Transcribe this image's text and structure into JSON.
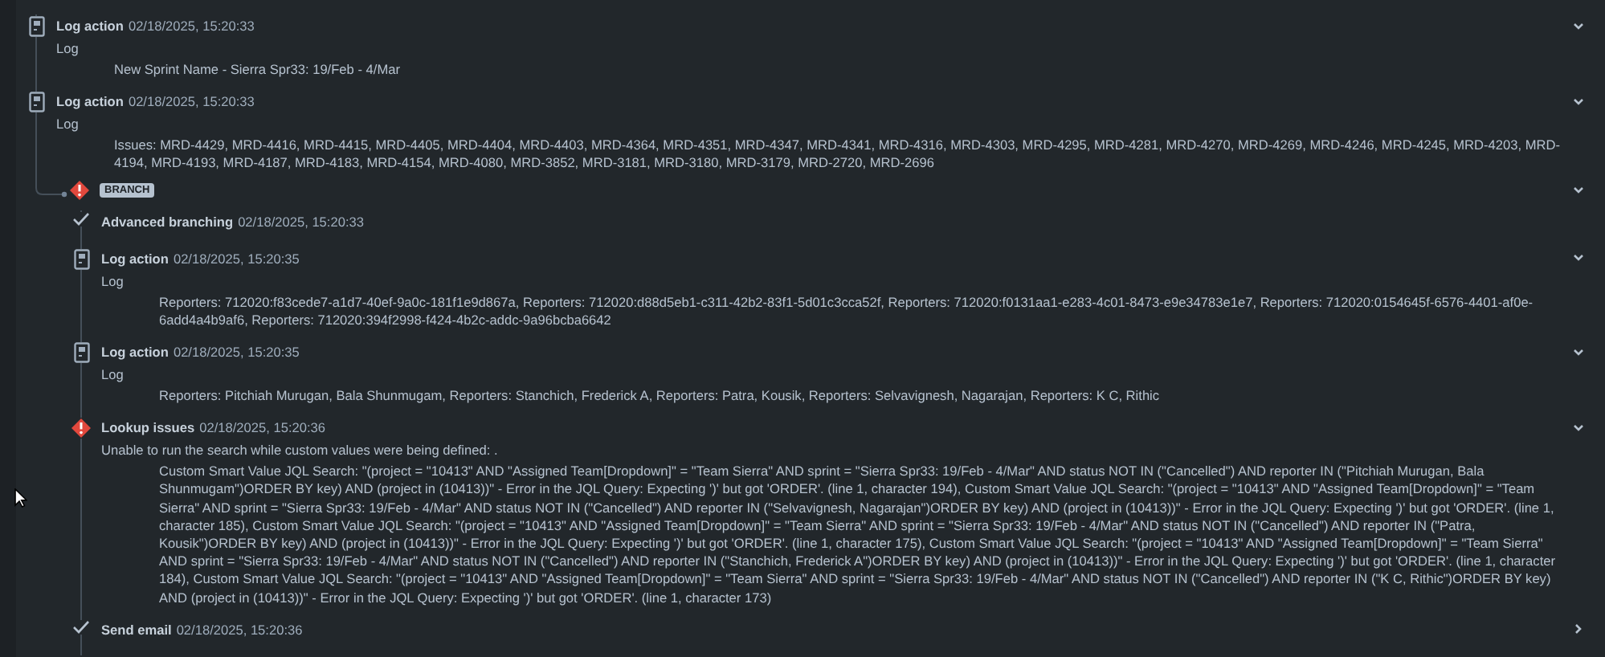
{
  "entries": [
    {
      "kind": "log",
      "title": "Log action",
      "time": "02/18/2025, 15:20:33",
      "label": "Log",
      "message": "New Sprint Name - Sierra Spr33: 19/Feb - 4/Mar",
      "expanded": true
    },
    {
      "kind": "log",
      "title": "Log action",
      "time": "02/18/2025, 15:20:33",
      "label": "Log",
      "message": "Issues: MRD-4429, MRD-4416, MRD-4415, MRD-4405, MRD-4404, MRD-4403, MRD-4364, MRD-4351, MRD-4347, MRD-4341, MRD-4316, MRD-4303, MRD-4295, MRD-4281, MRD-4270, MRD-4269, MRD-4246, MRD-4245, MRD-4203, MRD-4194, MRD-4193, MRD-4187, MRD-4183, MRD-4154, MRD-4080, MRD-3852, MRD-3181, MRD-3180, MRD-3179, MRD-2720, MRD-2696",
      "expanded": true
    }
  ],
  "branch": {
    "badge": "BRANCH",
    "expanded": true,
    "children": [
      {
        "kind": "check",
        "title": "Advanced branching",
        "time": "02/18/2025, 15:20:33"
      },
      {
        "kind": "log",
        "title": "Log action",
        "time": "02/18/2025, 15:20:35",
        "label": "Log",
        "message": "Reporters: 712020:f83cede7-a1d7-40ef-9a0c-181f1e9d867a, Reporters: 712020:d88d5eb1-c311-42b2-83f1-5d01c3cca52f, Reporters: 712020:f0131aa1-e283-4c01-8473-e9e34783e1e7, Reporters: 712020:0154645f-6576-4401-af0e-6add4a4b9af6, Reporters: 712020:394f2998-f424-4b2c-addc-9a96bcba6642",
        "expanded": true
      },
      {
        "kind": "log",
        "title": "Log action",
        "time": "02/18/2025, 15:20:35",
        "label": "Log",
        "message": "Reporters: Pitchiah Murugan, Bala Shunmugam, Reporters: Stanchich, Frederick A, Reporters: Patra, Kousik, Reporters: Selvavignesh, Nagarajan, Reporters: K C, Rithic",
        "expanded": true
      },
      {
        "kind": "error",
        "title": "Lookup issues",
        "time": "02/18/2025, 15:20:36",
        "label": "Unable to run the search while custom values were being defined: .",
        "message": "Custom Smart Value JQL Search: \"(project = \"10413\" AND \"Assigned Team[Dropdown]\" = \"Team Sierra\" AND sprint = \"Sierra Spr33: 19/Feb - 4/Mar\" AND status NOT IN (\"Cancelled\") AND reporter IN (\"Pitchiah Murugan, Bala Shunmugam\")ORDER BY key) AND (project in (10413))\" - Error in the JQL Query: Expecting ')' but got 'ORDER'. (line 1, character 194), Custom Smart Value JQL Search: \"(project = \"10413\" AND \"Assigned Team[Dropdown]\" = \"Team Sierra\" AND sprint = \"Sierra Spr33: 19/Feb - 4/Mar\" AND status NOT IN (\"Cancelled\") AND reporter IN (\"Selvavignesh, Nagarajan\")ORDER BY key) AND (project in (10413))\" - Error in the JQL Query: Expecting ')' but got 'ORDER'. (line 1, character 185), Custom Smart Value JQL Search: \"(project = \"10413\" AND \"Assigned Team[Dropdown]\" = \"Team Sierra\" AND sprint = \"Sierra Spr33: 19/Feb - 4/Mar\" AND status NOT IN (\"Cancelled\") AND reporter IN (\"Patra, Kousik\")ORDER BY key) AND (project in (10413))\" - Error in the JQL Query: Expecting ')' but got 'ORDER'. (line 1, character 175), Custom Smart Value JQL Search: \"(project = \"10413\" AND \"Assigned Team[Dropdown]\" = \"Team Sierra\" AND sprint = \"Sierra Spr33: 19/Feb - 4/Mar\" AND status NOT IN (\"Cancelled\") AND reporter IN (\"Stanchich, Frederick A\")ORDER BY key) AND (project in (10413))\" - Error in the JQL Query: Expecting ')' but got 'ORDER'. (line 1, character 184), Custom Smart Value JQL Search: \"(project = \"10413\" AND \"Assigned Team[Dropdown]\" = \"Team Sierra\" AND sprint = \"Sierra Spr33: 19/Feb - 4/Mar\" AND status NOT IN (\"Cancelled\") AND reporter IN (\"K C, Rithic\")ORDER BY key) AND (project in (10413))\" - Error in the JQL Query: Expecting ')' but got 'ORDER'. (line 1, character 173)",
        "expanded": true
      },
      {
        "kind": "check",
        "title": "Send email",
        "time": "02/18/2025, 15:20:36",
        "expanded": false
      }
    ]
  }
}
